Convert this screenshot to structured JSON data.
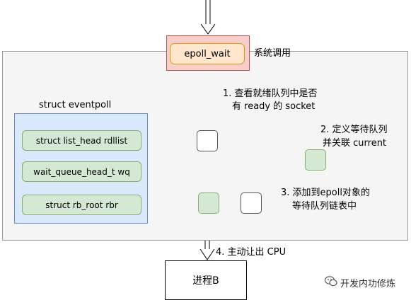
{
  "syscall": {
    "button": "epoll_wait",
    "label": "系统调用"
  },
  "steps": {
    "step1_line1": "1. 查看就绪队列中是否",
    "step1_line2": "有 ready 的 socket",
    "step2_line1": "2. 定义等待队列",
    "step2_line2": "并关联 current",
    "step3_line1": "3. 添加到epoll对象的",
    "step3_line2": "等待队列链表中",
    "step4": "4. 主动让出 CPU"
  },
  "eventpoll": {
    "title": "struct eventpoll",
    "fields": [
      "struct list_head rdllist",
      "wait_queue_head_t wq",
      "struct rb_root rbr"
    ]
  },
  "process": {
    "label": "进程B"
  },
  "watermark": {
    "text": "开发内功修炼",
    "icon": "wechat-icon"
  }
}
